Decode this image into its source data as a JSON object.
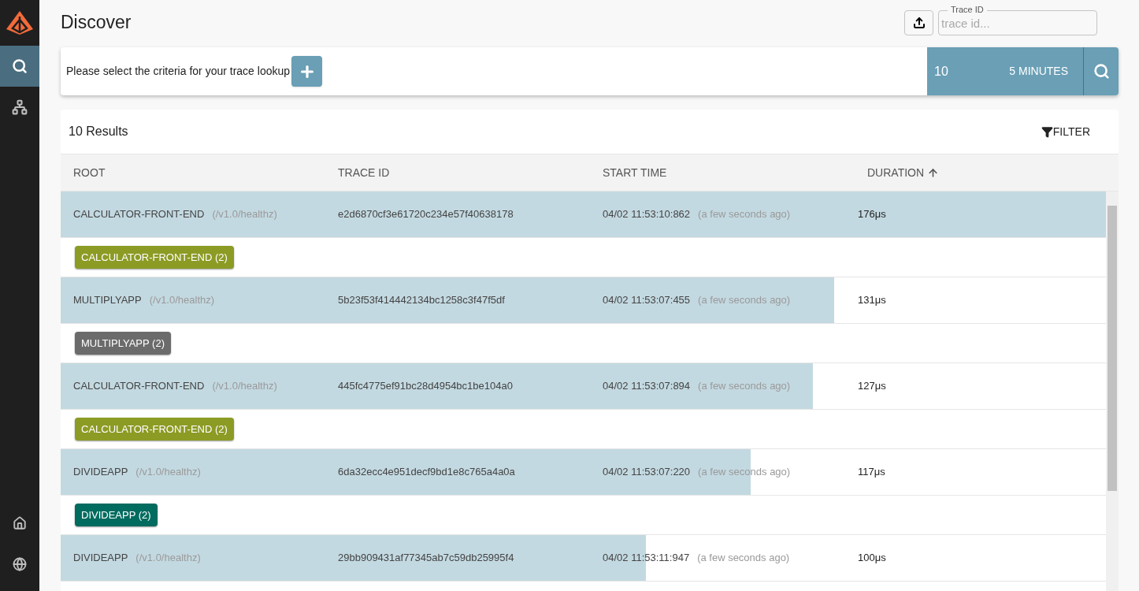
{
  "sidebar": {
    "items": [
      {
        "kind": "search",
        "selected": true
      },
      {
        "kind": "dependencies",
        "selected": false
      }
    ],
    "bottom_items": [
      {
        "kind": "home"
      },
      {
        "kind": "globe"
      }
    ]
  },
  "header": {
    "title": "Discover",
    "trace_id_field": {
      "label": "Trace ID",
      "placeholder": "trace id..."
    }
  },
  "criteria_bar": {
    "prompt": "Please select the criteria for your trace lookup",
    "limit": "10",
    "lookback": "5 MINUTES"
  },
  "results": {
    "count": "10 Results",
    "filter_button": "FILTER",
    "columns": [
      "ROOT",
      "TRACE ID",
      "START TIME",
      "DURATION"
    ],
    "rows": [
      {
        "service": "CALCULATOR-FRONT-END",
        "path": "(/v1.0/healthz)",
        "trace_id": "e2d6870cf3e61720c234e57f40638178",
        "start_time": "04/02 11:53:10:862",
        "relative_time": "(a few seconds ago)",
        "duration": "176μs",
        "level": 1,
        "badges": [
          {
            "label": "CALCULATOR-FRONT-END (2)",
            "color": "#8c9b24"
          }
        ]
      },
      {
        "service": "MULTIPLYAPP",
        "path": "(/v1.0/healthz)",
        "trace_id": "5b23f53f414442134bc1258c3f47f5df",
        "start_time": "04/02 11:53:07:455",
        "relative_time": "(a few seconds ago)",
        "duration": "131μs",
        "level": 0.74,
        "badges": [
          {
            "label": "MULTIPLYAPP (2)",
            "color": "#6b6b6b"
          }
        ]
      },
      {
        "service": "CALCULATOR-FRONT-END",
        "path": "(/v1.0/healthz)",
        "trace_id": "445fc4775ef91bc28d4954bc1be104a0",
        "start_time": "04/02 11:53:07:894",
        "relative_time": "(a few seconds ago)",
        "duration": "127μs",
        "level": 0.72,
        "badges": [
          {
            "label": "CALCULATOR-FRONT-END (2)",
            "color": "#8c9b24"
          }
        ]
      },
      {
        "service": "DIVIDEAPP",
        "path": "(/v1.0/healthz)",
        "trace_id": "6da32ecc4e951decf9bd1e8c765a4a0a",
        "start_time": "04/02 11:53:07:220",
        "relative_time": "(a few seconds ago)",
        "duration": "117μs",
        "level": 0.66,
        "badges": [
          {
            "label": "DIVIDEAPP (2)",
            "color": "#006b5f"
          }
        ]
      },
      {
        "service": "DIVIDEAPP",
        "path": "(/v1.0/healthz)",
        "trace_id": "29bb909431af77345ab7c59db25995f4",
        "start_time": "04/02 11:53:11:947",
        "relative_time": "(a few seconds ago)",
        "duration": "100μs",
        "level": 0.56,
        "badges": []
      }
    ]
  }
}
